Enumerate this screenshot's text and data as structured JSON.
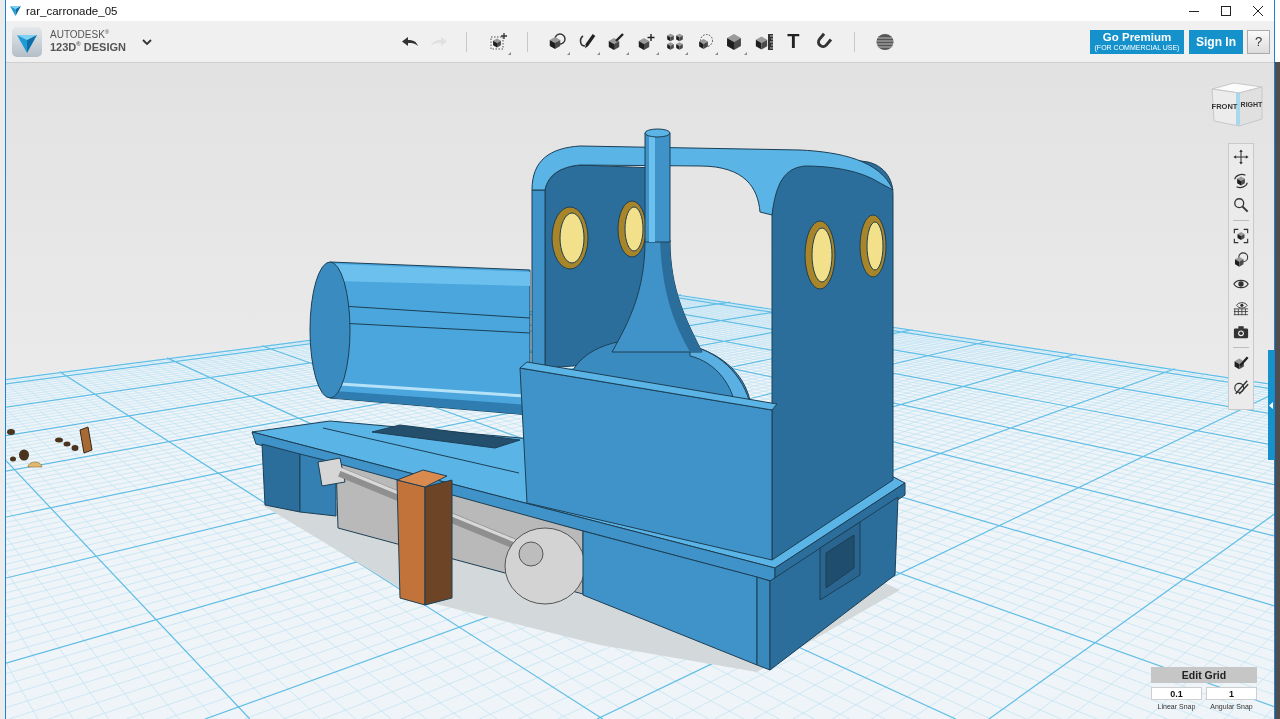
{
  "window": {
    "title": "rar_carronade_05"
  },
  "app_bar": {
    "brand": [
      "AUTODESK$^{®}$",
      "123D$^{®}$ DESIGN"
    ]
  },
  "toolbar": {
    "groups": [
      {
        "items": [
          {
            "kind": "undo",
            "disabled": false,
            "menu": false
          },
          {
            "kind": "redo",
            "disabled": true,
            "menu": false
          }
        ]
      },
      {
        "items": [
          {
            "kind": "transform",
            "disabled": false,
            "menu": true
          }
        ]
      },
      {
        "items": [
          {
            "kind": "primitives",
            "disabled": false,
            "menu": true
          },
          {
            "kind": "sketch",
            "disabled": false,
            "menu": true
          },
          {
            "kind": "construct",
            "disabled": false,
            "menu": true
          },
          {
            "kind": "modify",
            "disabled": false,
            "menu": true
          },
          {
            "kind": "pattern",
            "disabled": false,
            "menu": true
          },
          {
            "kind": "grouping",
            "disabled": false,
            "menu": true
          },
          {
            "kind": "combine",
            "disabled": false,
            "menu": true
          },
          {
            "kind": "measure",
            "disabled": false,
            "menu": false
          },
          {
            "kind": "text",
            "label": "T",
            "disabled": false,
            "menu": false
          },
          {
            "kind": "snap",
            "disabled": false,
            "menu": false
          }
        ]
      },
      {
        "items": [
          {
            "kind": "materials",
            "disabled": false,
            "menu": false
          }
        ]
      }
    ]
  },
  "account": {
    "premium": {
      "label": "Go Premium",
      "note": "(FOR COMMERCIAL USE)"
    },
    "sign_in": "Sign In",
    "help": "?"
  },
  "view_cube": {
    "faces": [
      "FRONT",
      "RIGHT"
    ]
  },
  "navigation": {
    "groups": [
      {
        "items": [
          {
            "kind": "pan"
          },
          {
            "kind": "orbit"
          },
          {
            "kind": "zoom"
          }
        ]
      },
      {
        "items": [
          {
            "kind": "fit"
          },
          {
            "kind": "view"
          },
          {
            "kind": "visibility"
          },
          {
            "kind": "display"
          },
          {
            "kind": "camera"
          }
        ]
      },
      {
        "items": [
          {
            "kind": "edit"
          },
          {
            "kind": "paint"
          }
        ]
      }
    ]
  },
  "edit_grid": {
    "button": "Edit Grid",
    "fields": [
      {
        "value": "0.1",
        "label": "Linear Snap"
      },
      {
        "value": "1",
        "label": "Angular Snap"
      }
    ]
  }
}
